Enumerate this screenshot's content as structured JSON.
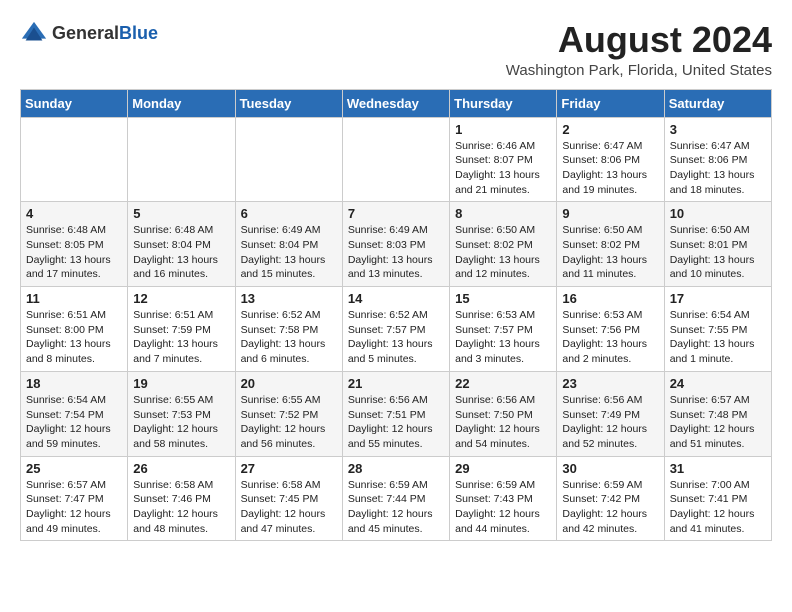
{
  "logo": {
    "general": "General",
    "blue": "Blue"
  },
  "title": "August 2024",
  "location": "Washington Park, Florida, United States",
  "days_of_week": [
    "Sunday",
    "Monday",
    "Tuesday",
    "Wednesday",
    "Thursday",
    "Friday",
    "Saturday"
  ],
  "weeks": [
    [
      {
        "day": "",
        "info": ""
      },
      {
        "day": "",
        "info": ""
      },
      {
        "day": "",
        "info": ""
      },
      {
        "day": "",
        "info": ""
      },
      {
        "day": "1",
        "info": "Sunrise: 6:46 AM\nSunset: 8:07 PM\nDaylight: 13 hours and 21 minutes."
      },
      {
        "day": "2",
        "info": "Sunrise: 6:47 AM\nSunset: 8:06 PM\nDaylight: 13 hours and 19 minutes."
      },
      {
        "day": "3",
        "info": "Sunrise: 6:47 AM\nSunset: 8:06 PM\nDaylight: 13 hours and 18 minutes."
      }
    ],
    [
      {
        "day": "4",
        "info": "Sunrise: 6:48 AM\nSunset: 8:05 PM\nDaylight: 13 hours and 17 minutes."
      },
      {
        "day": "5",
        "info": "Sunrise: 6:48 AM\nSunset: 8:04 PM\nDaylight: 13 hours and 16 minutes."
      },
      {
        "day": "6",
        "info": "Sunrise: 6:49 AM\nSunset: 8:04 PM\nDaylight: 13 hours and 15 minutes."
      },
      {
        "day": "7",
        "info": "Sunrise: 6:49 AM\nSunset: 8:03 PM\nDaylight: 13 hours and 13 minutes."
      },
      {
        "day": "8",
        "info": "Sunrise: 6:50 AM\nSunset: 8:02 PM\nDaylight: 13 hours and 12 minutes."
      },
      {
        "day": "9",
        "info": "Sunrise: 6:50 AM\nSunset: 8:02 PM\nDaylight: 13 hours and 11 minutes."
      },
      {
        "day": "10",
        "info": "Sunrise: 6:50 AM\nSunset: 8:01 PM\nDaylight: 13 hours and 10 minutes."
      }
    ],
    [
      {
        "day": "11",
        "info": "Sunrise: 6:51 AM\nSunset: 8:00 PM\nDaylight: 13 hours and 8 minutes."
      },
      {
        "day": "12",
        "info": "Sunrise: 6:51 AM\nSunset: 7:59 PM\nDaylight: 13 hours and 7 minutes."
      },
      {
        "day": "13",
        "info": "Sunrise: 6:52 AM\nSunset: 7:58 PM\nDaylight: 13 hours and 6 minutes."
      },
      {
        "day": "14",
        "info": "Sunrise: 6:52 AM\nSunset: 7:57 PM\nDaylight: 13 hours and 5 minutes."
      },
      {
        "day": "15",
        "info": "Sunrise: 6:53 AM\nSunset: 7:57 PM\nDaylight: 13 hours and 3 minutes."
      },
      {
        "day": "16",
        "info": "Sunrise: 6:53 AM\nSunset: 7:56 PM\nDaylight: 13 hours and 2 minutes."
      },
      {
        "day": "17",
        "info": "Sunrise: 6:54 AM\nSunset: 7:55 PM\nDaylight: 13 hours and 1 minute."
      }
    ],
    [
      {
        "day": "18",
        "info": "Sunrise: 6:54 AM\nSunset: 7:54 PM\nDaylight: 12 hours and 59 minutes."
      },
      {
        "day": "19",
        "info": "Sunrise: 6:55 AM\nSunset: 7:53 PM\nDaylight: 12 hours and 58 minutes."
      },
      {
        "day": "20",
        "info": "Sunrise: 6:55 AM\nSunset: 7:52 PM\nDaylight: 12 hours and 56 minutes."
      },
      {
        "day": "21",
        "info": "Sunrise: 6:56 AM\nSunset: 7:51 PM\nDaylight: 12 hours and 55 minutes."
      },
      {
        "day": "22",
        "info": "Sunrise: 6:56 AM\nSunset: 7:50 PM\nDaylight: 12 hours and 54 minutes."
      },
      {
        "day": "23",
        "info": "Sunrise: 6:56 AM\nSunset: 7:49 PM\nDaylight: 12 hours and 52 minutes."
      },
      {
        "day": "24",
        "info": "Sunrise: 6:57 AM\nSunset: 7:48 PM\nDaylight: 12 hours and 51 minutes."
      }
    ],
    [
      {
        "day": "25",
        "info": "Sunrise: 6:57 AM\nSunset: 7:47 PM\nDaylight: 12 hours and 49 minutes."
      },
      {
        "day": "26",
        "info": "Sunrise: 6:58 AM\nSunset: 7:46 PM\nDaylight: 12 hours and 48 minutes."
      },
      {
        "day": "27",
        "info": "Sunrise: 6:58 AM\nSunset: 7:45 PM\nDaylight: 12 hours and 47 minutes."
      },
      {
        "day": "28",
        "info": "Sunrise: 6:59 AM\nSunset: 7:44 PM\nDaylight: 12 hours and 45 minutes."
      },
      {
        "day": "29",
        "info": "Sunrise: 6:59 AM\nSunset: 7:43 PM\nDaylight: 12 hours and 44 minutes."
      },
      {
        "day": "30",
        "info": "Sunrise: 6:59 AM\nSunset: 7:42 PM\nDaylight: 12 hours and 42 minutes."
      },
      {
        "day": "31",
        "info": "Sunrise: 7:00 AM\nSunset: 7:41 PM\nDaylight: 12 hours and 41 minutes."
      }
    ]
  ]
}
